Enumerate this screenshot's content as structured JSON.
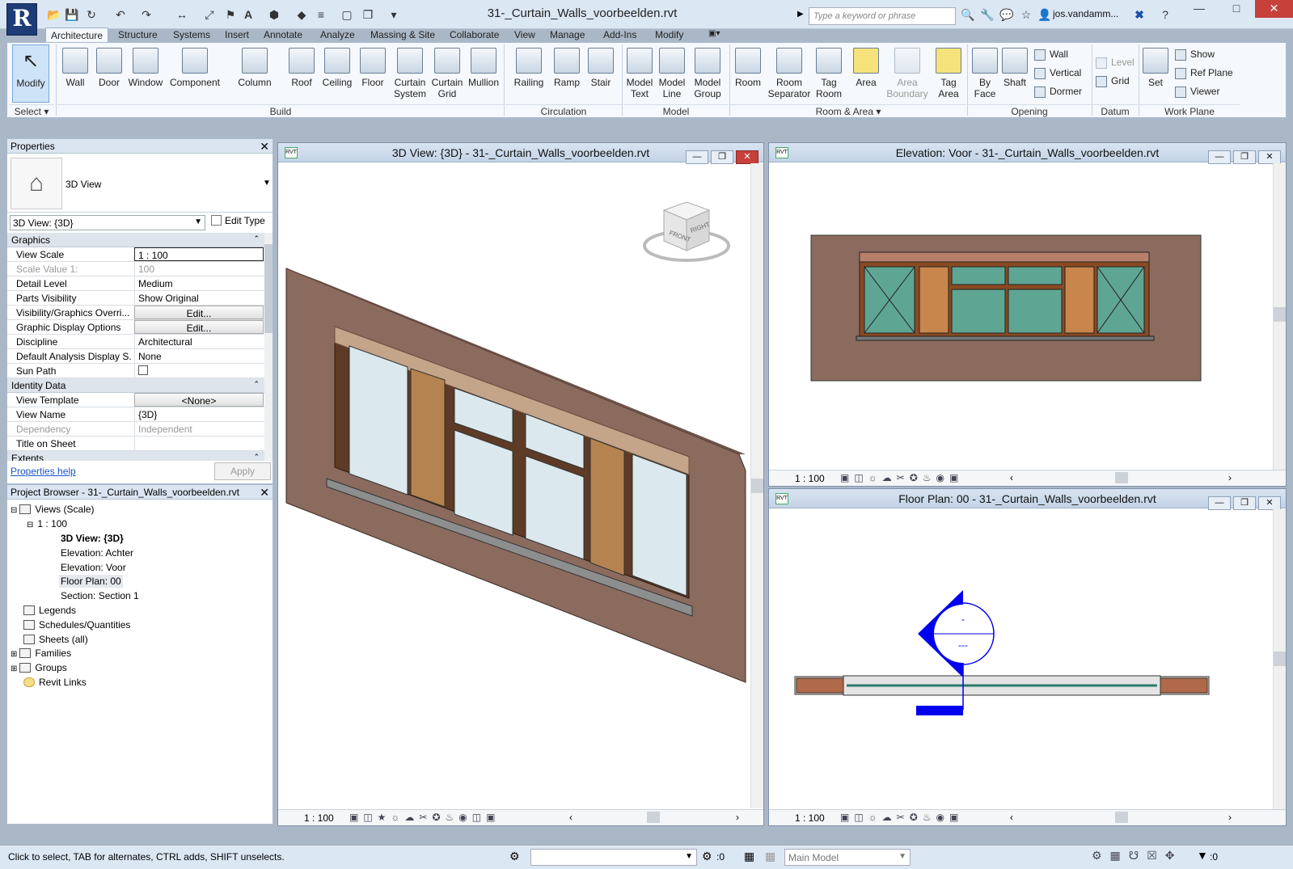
{
  "app": {
    "logo": "R",
    "document_title": "31-_Curtain_Walls_voorbeelden.rvt"
  },
  "search": {
    "placeholder": "Type a keyword or phrase"
  },
  "user": {
    "name": "jos.vandamm..."
  },
  "tabs": [
    "Architecture",
    "Structure",
    "Systems",
    "Insert",
    "Annotate",
    "Analyze",
    "Massing & Site",
    "Collaborate",
    "View",
    "Manage",
    "Add-Ins",
    "Modify"
  ],
  "ribbon": {
    "modify": "Modify",
    "select": "Select",
    "build": [
      {
        "l1": "Wall",
        "l2": ""
      },
      {
        "l1": "Door",
        "l2": ""
      },
      {
        "l1": "Window",
        "l2": ""
      },
      {
        "l1": "Component",
        "l2": ""
      },
      {
        "l1": "Column",
        "l2": ""
      },
      {
        "l1": "Roof",
        "l2": ""
      },
      {
        "l1": "Ceiling",
        "l2": ""
      },
      {
        "l1": "Floor",
        "l2": ""
      },
      {
        "l1": "Curtain",
        "l2": "System"
      },
      {
        "l1": "Curtain",
        "l2": "Grid"
      },
      {
        "l1": "Mullion",
        "l2": ""
      }
    ],
    "circulation": [
      {
        "l1": "Railing",
        "l2": ""
      },
      {
        "l1": "Ramp",
        "l2": ""
      },
      {
        "l1": "Stair",
        "l2": ""
      }
    ],
    "model": [
      {
        "l1": "Model",
        "l2": "Text"
      },
      {
        "l1": "Model",
        "l2": "Line"
      },
      {
        "l1": "Model",
        "l2": "Group"
      }
    ],
    "room_area": [
      {
        "l1": "Room",
        "l2": ""
      },
      {
        "l1": "Room",
        "l2": "Separator"
      },
      {
        "l1": "Tag",
        "l2": "Room"
      },
      {
        "l1": "Area",
        "l2": ""
      },
      {
        "l1": "Area",
        "l2": "Boundary"
      },
      {
        "l1": "Tag",
        "l2": "Area"
      }
    ],
    "opening": [
      {
        "l1": "By",
        "l2": "Face"
      },
      {
        "l1": "Shaft",
        "l2": ""
      }
    ],
    "opening_small": [
      "Wall",
      "Vertical",
      "Dormer"
    ],
    "datum_small": [
      "Level",
      "Grid"
    ],
    "workplane_set": "Set",
    "workplane_small": [
      "Show",
      "Ref  Plane",
      "Viewer"
    ],
    "groups": [
      "Select",
      "Build",
      "Circulation",
      "Model",
      "Room & Area",
      "Opening",
      "Datum",
      "Work Plane"
    ]
  },
  "properties": {
    "title": "Properties",
    "type_name": "3D View",
    "selector": "3D View: {3D}",
    "edit_type": "Edit Type",
    "categories": [
      "Graphics",
      "Identity Data",
      "Extents"
    ],
    "rows": [
      {
        "k": "View Scale",
        "v": "1 : 100"
      },
      {
        "k": "Scale Value    1:",
        "v": "100"
      },
      {
        "k": "Detail Level",
        "v": "Medium"
      },
      {
        "k": "Parts Visibility",
        "v": "Show Original"
      },
      {
        "k": "Visibility/Graphics Overri...",
        "v": "Edit..."
      },
      {
        "k": "Graphic Display Options",
        "v": "Edit..."
      },
      {
        "k": "Discipline",
        "v": "Architectural"
      },
      {
        "k": "Default Analysis Display S...",
        "v": "None"
      },
      {
        "k": "Sun Path",
        "v": ""
      },
      {
        "k": "View Template",
        "v": "<None>"
      },
      {
        "k": "View Name",
        "v": "{3D}"
      },
      {
        "k": "Dependency",
        "v": "Independent"
      },
      {
        "k": "Title on Sheet",
        "v": ""
      }
    ],
    "help": "Properties help",
    "apply": "Apply"
  },
  "browser": {
    "title": "Project Browser - 31-_Curtain_Walls_voorbeelden.rvt",
    "items": [
      "Views (Scale)",
      "1 : 100",
      "3D View: {3D}",
      "Elevation: Achter",
      "Elevation: Voor",
      "Floor Plan: 00",
      "Section: Section 1",
      "Legends",
      "Schedules/Quantities",
      "Sheets (all)",
      "Families",
      "Groups",
      "Revit Links"
    ]
  },
  "views": {
    "v3d": {
      "title": "3D View: {3D} - 31-_Curtain_Walls_voorbeelden.rvt",
      "scale": "1 : 100",
      "cube_front": "FRONT",
      "cube_right": "RIGHT"
    },
    "elev": {
      "title": "Elevation: Voor - 31-_Curtain_Walls_voorbeelden.rvt",
      "scale": "1 : 100"
    },
    "plan": {
      "title": "Floor Plan: 00 - 31-_Curtain_Walls_voorbeelden.rvt",
      "scale": "1 : 100",
      "tag_top": "-",
      "tag_bottom": "---"
    }
  },
  "status": {
    "hint": "Click to select, TAB for alternates, CTRL adds, SHIFT unselects.",
    "count1": ":0",
    "model": "Main Model",
    "count2": ":0"
  },
  "colors": {
    "brick": "#8b6b5e",
    "frame": "#8a4a22",
    "glass": "#dbe9ef",
    "elev_glass": "#5fa593",
    "panel": "#c8864c",
    "section_blue": "#0000ee"
  }
}
